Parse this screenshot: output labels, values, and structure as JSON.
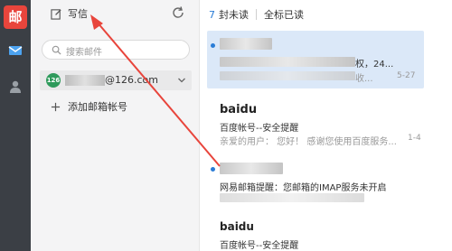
{
  "app": {
    "logo_char": "邮",
    "brand_color": "#e8453c"
  },
  "sidebar": {
    "compose_label": "写信",
    "search_placeholder": "搜索邮件",
    "account": {
      "badge": "126",
      "domain": "@126.com"
    },
    "add_account_label": "添加邮箱帐号"
  },
  "header": {
    "unread_count": "7",
    "unread_label": "封未读",
    "mark_all_read": "全标已读"
  },
  "messages": [
    {
      "sender": "",
      "subject": "",
      "preview_tail": "权，24...",
      "preview2_tail": "收...",
      "date": "5-27",
      "selected": true
    },
    {
      "sender": "baidu",
      "subject": "百度帐号--安全提醒",
      "preview": "亲爱的用户： 您好！ 感谢您使用百度服务...",
      "date": "1-4"
    },
    {
      "sender": "",
      "subject": "网易邮箱提醒：您邮箱的IMAP服务未开启",
      "preview": ""
    },
    {
      "sender": "baidu",
      "subject": "百度帐号--安全提醒"
    }
  ],
  "colors": {
    "accent": "#2a7cd6",
    "rail": "#3b3f45",
    "annotation_arrow": "#e8453c"
  }
}
